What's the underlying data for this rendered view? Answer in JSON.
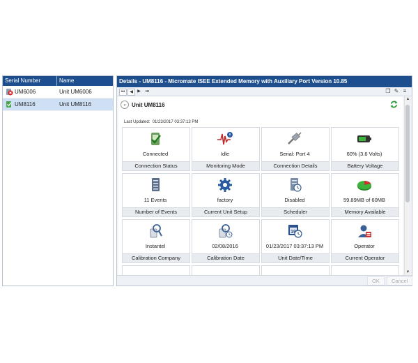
{
  "list": {
    "columns": [
      "Serial Number",
      "Name"
    ],
    "rows": [
      {
        "serial": "UM6006",
        "name": "Unit UM6006",
        "icon": "unit-disconnected-icon"
      },
      {
        "serial": "UM8116",
        "name": "Unit UM8116",
        "icon": "unit-connected-icon"
      }
    ]
  },
  "details": {
    "header": "Details - UM8116 - Micromate  ISEE Extended Memory with Auxiliary Port Version 10.85",
    "unit_title": "Unit UM8116",
    "last_updated_label": "Last Updated:",
    "last_updated_value": "01/23/2017 03:37:13 PM"
  },
  "tiles": [
    {
      "value": "Connected",
      "label": "Connection Status",
      "icon": "connected-check-icon"
    },
    {
      "value": "Idle",
      "label": "Monitoring Mode",
      "icon": "waveform-icon"
    },
    {
      "value": "Serial: Port 4",
      "label": "Connection Details",
      "icon": "serial-cable-icon"
    },
    {
      "value": "60% (3.6 Volts)",
      "label": "Battery Voltage",
      "icon": "battery-icon"
    },
    {
      "value": "11 Events",
      "label": "Number of Events",
      "icon": "events-stack-icon"
    },
    {
      "value": "factory",
      "label": "Current Unit Setup",
      "icon": "gear-icon"
    },
    {
      "value": "Disabled",
      "label": "Scheduler",
      "icon": "scheduler-icon"
    },
    {
      "value": "59.89MB of 60MB",
      "label": "Memory Available",
      "icon": "memory-pie-icon"
    },
    {
      "value": "Instantel",
      "label": "Calibration Company",
      "icon": "calibration-company-icon"
    },
    {
      "value": "02/08/2016",
      "label": "Calibration Date",
      "icon": "calibration-date-icon"
    },
    {
      "value": "01/23/2017 03:37:13 PM",
      "label": "Unit Date/Time",
      "icon": "calendar-clock-icon"
    },
    {
      "value": "Operator",
      "label": "Current Operator",
      "icon": "operator-icon"
    }
  ],
  "footer": {
    "ok": "OK",
    "cancel": "Cancel"
  }
}
